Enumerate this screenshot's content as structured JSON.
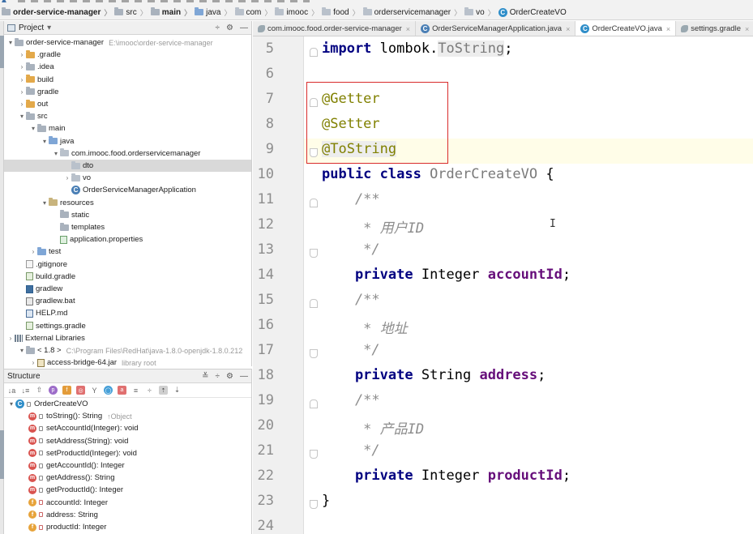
{
  "breadcrumb": [
    {
      "label": "order-service-manager",
      "icon": "module-icon",
      "bold": true
    },
    {
      "label": "src",
      "icon": "folder-icon"
    },
    {
      "label": "main",
      "icon": "folder-icon",
      "bold": true
    },
    {
      "label": "java",
      "icon": "source-folder-icon"
    },
    {
      "label": "com",
      "icon": "package-icon"
    },
    {
      "label": "imooc",
      "icon": "package-icon"
    },
    {
      "label": "food",
      "icon": "package-icon"
    },
    {
      "label": "orderservicemanager",
      "icon": "package-icon"
    },
    {
      "label": "vo",
      "icon": "package-icon"
    },
    {
      "label": "OrderCreateVO",
      "icon": "class-icon"
    }
  ],
  "project_panel": {
    "title": "Project",
    "dropdown_glyph": "▾",
    "tools": [
      "÷",
      "⚙",
      "—"
    ],
    "tree": [
      {
        "depth": 0,
        "arrow": "▾",
        "icon": "module",
        "label": "order-service-manager",
        "hint": "E:\\imooc\\order-service-manager"
      },
      {
        "depth": 1,
        "arrow": "›",
        "icon": "folder-orange",
        "label": ".gradle"
      },
      {
        "depth": 1,
        "arrow": "›",
        "icon": "folder",
        "label": ".idea"
      },
      {
        "depth": 1,
        "arrow": "›",
        "icon": "folder-orange",
        "label": "build"
      },
      {
        "depth": 1,
        "arrow": "›",
        "icon": "folder",
        "label": "gradle"
      },
      {
        "depth": 1,
        "arrow": "›",
        "icon": "folder-orange",
        "label": "out"
      },
      {
        "depth": 1,
        "arrow": "▾",
        "icon": "folder",
        "label": "src"
      },
      {
        "depth": 2,
        "arrow": "▾",
        "icon": "folder",
        "label": "main"
      },
      {
        "depth": 3,
        "arrow": "▾",
        "icon": "folder-src",
        "label": "java"
      },
      {
        "depth": 4,
        "arrow": "▾",
        "icon": "package",
        "label": "com.imooc.food.orderservicemanager"
      },
      {
        "depth": 5,
        "arrow": "",
        "icon": "package",
        "label": "dto",
        "selected": true
      },
      {
        "depth": 5,
        "arrow": "›",
        "icon": "package",
        "label": "vo"
      },
      {
        "depth": 5,
        "arrow": "",
        "icon": "spring-class",
        "label": "OrderServiceManagerApplication"
      },
      {
        "depth": 3,
        "arrow": "▾",
        "icon": "folder-res",
        "label": "resources"
      },
      {
        "depth": 4,
        "arrow": "",
        "icon": "folder",
        "label": "static"
      },
      {
        "depth": 4,
        "arrow": "",
        "icon": "folder",
        "label": "templates"
      },
      {
        "depth": 4,
        "arrow": "",
        "icon": "props",
        "label": "application.properties"
      },
      {
        "depth": 2,
        "arrow": "›",
        "icon": "folder-src",
        "label": "test"
      },
      {
        "depth": 1,
        "arrow": "",
        "icon": "file",
        "label": ".gitignore"
      },
      {
        "depth": 1,
        "arrow": "",
        "icon": "gradle",
        "label": "build.gradle"
      },
      {
        "depth": 1,
        "arrow": "",
        "icon": "term",
        "label": "gradlew"
      },
      {
        "depth": 1,
        "arrow": "",
        "icon": "bat",
        "label": "gradlew.bat"
      },
      {
        "depth": 1,
        "arrow": "",
        "icon": "md",
        "label": "HELP.md"
      },
      {
        "depth": 1,
        "arrow": "",
        "icon": "gradle",
        "label": "settings.gradle"
      },
      {
        "depth": 0,
        "arrow": "›",
        "icon": "lib",
        "label": "External Libraries"
      },
      {
        "depth": 1,
        "arrow": "▾",
        "icon": "folder",
        "label": "< 1.8 >",
        "hint": "C:\\Program Files\\RedHat\\java-1.8.0-openjdk-1.8.0.212"
      },
      {
        "depth": 2,
        "arrow": "›",
        "icon": "jar",
        "label": "access-bridge-64.jar",
        "hint": "library root"
      }
    ]
  },
  "structure_panel": {
    "title": "Structure",
    "tools": [
      "≚",
      "÷",
      "⚙",
      "—"
    ],
    "class_name": "OrderCreateVO",
    "members": [
      {
        "kind": "m",
        "label": "toString(): String",
        "hint": "↑Object"
      },
      {
        "kind": "m",
        "label": "setAccountId(Integer): void"
      },
      {
        "kind": "m",
        "label": "setAddress(String): void"
      },
      {
        "kind": "m",
        "label": "setProductId(Integer): void"
      },
      {
        "kind": "m",
        "label": "getAccountId(): Integer"
      },
      {
        "kind": "m",
        "label": "getAddress(): String"
      },
      {
        "kind": "m",
        "label": "getProductId(): Integer"
      },
      {
        "kind": "f",
        "label": "accountId: Integer"
      },
      {
        "kind": "f",
        "label": "address: String"
      },
      {
        "kind": "f",
        "label": "productId: Integer"
      }
    ]
  },
  "tabs": [
    {
      "label": "com.imooc.food.order-service-manager",
      "icon": "gradle-icon",
      "active": false
    },
    {
      "label": "OrderServiceManagerApplication.java",
      "icon": "spring-class-icon",
      "active": false
    },
    {
      "label": "OrderCreateVO.java",
      "icon": "class-icon",
      "active": true
    },
    {
      "label": "settings.gradle",
      "icon": "gradle-icon",
      "active": false
    }
  ],
  "editor": {
    "lines": [
      {
        "n": "5",
        "tokens": [
          [
            "kw",
            "import"
          ],
          [
            "plain",
            " lombok."
          ],
          [
            "hl",
            "ToString"
          ],
          [
            "plain",
            ";"
          ]
        ]
      },
      {
        "n": "6",
        "tokens": []
      },
      {
        "n": "7",
        "tokens": [
          [
            "ann",
            "@Getter"
          ]
        ]
      },
      {
        "n": "8",
        "tokens": [
          [
            "ann",
            "@Setter"
          ]
        ]
      },
      {
        "n": "9",
        "tokens": [
          [
            "annhl",
            "@ToString"
          ]
        ]
      },
      {
        "n": "10",
        "tokens": [
          [
            "kw",
            "public class "
          ],
          [
            "cls",
            "OrderCreateVO"
          ],
          [
            "plain",
            " {"
          ]
        ]
      },
      {
        "n": "11",
        "tokens": [
          [
            "cmt",
            "    /**"
          ]
        ]
      },
      {
        "n": "12",
        "tokens": [
          [
            "cmt",
            "     * 用户ID"
          ]
        ]
      },
      {
        "n": "13",
        "tokens": [
          [
            "cmt",
            "     */"
          ]
        ]
      },
      {
        "n": "14",
        "tokens": [
          [
            "kw",
            "    private "
          ],
          [
            "plain",
            "Integer "
          ],
          [
            "fld",
            "accountId"
          ],
          [
            "plain",
            ";"
          ]
        ]
      },
      {
        "n": "15",
        "tokens": [
          [
            "cmt",
            "    /**"
          ]
        ]
      },
      {
        "n": "16",
        "tokens": [
          [
            "cmt",
            "     * 地址"
          ]
        ]
      },
      {
        "n": "17",
        "tokens": [
          [
            "cmt",
            "     */"
          ]
        ]
      },
      {
        "n": "18",
        "tokens": [
          [
            "kw",
            "    private "
          ],
          [
            "plain",
            "String "
          ],
          [
            "fld",
            "address"
          ],
          [
            "plain",
            ";"
          ]
        ]
      },
      {
        "n": "19",
        "tokens": [
          [
            "cmt",
            "    /**"
          ]
        ]
      },
      {
        "n": "20",
        "tokens": [
          [
            "cmt",
            "     * 产品ID"
          ]
        ]
      },
      {
        "n": "21",
        "tokens": [
          [
            "cmt",
            "     */"
          ]
        ]
      },
      {
        "n": "22",
        "tokens": [
          [
            "kw",
            "    private "
          ],
          [
            "plain",
            "Integer "
          ],
          [
            "fld",
            "productId"
          ],
          [
            "plain",
            ";"
          ]
        ]
      },
      {
        "n": "23",
        "tokens": [
          [
            "plain",
            "}"
          ]
        ]
      },
      {
        "n": "24",
        "tokens": []
      }
    ],
    "caret_glyph": "I"
  },
  "colors": {
    "keyword": "#000080",
    "annotation": "#808000",
    "field": "#660e7a",
    "comment": "#8c8c8c",
    "highlight_box": "#d92b2b"
  }
}
